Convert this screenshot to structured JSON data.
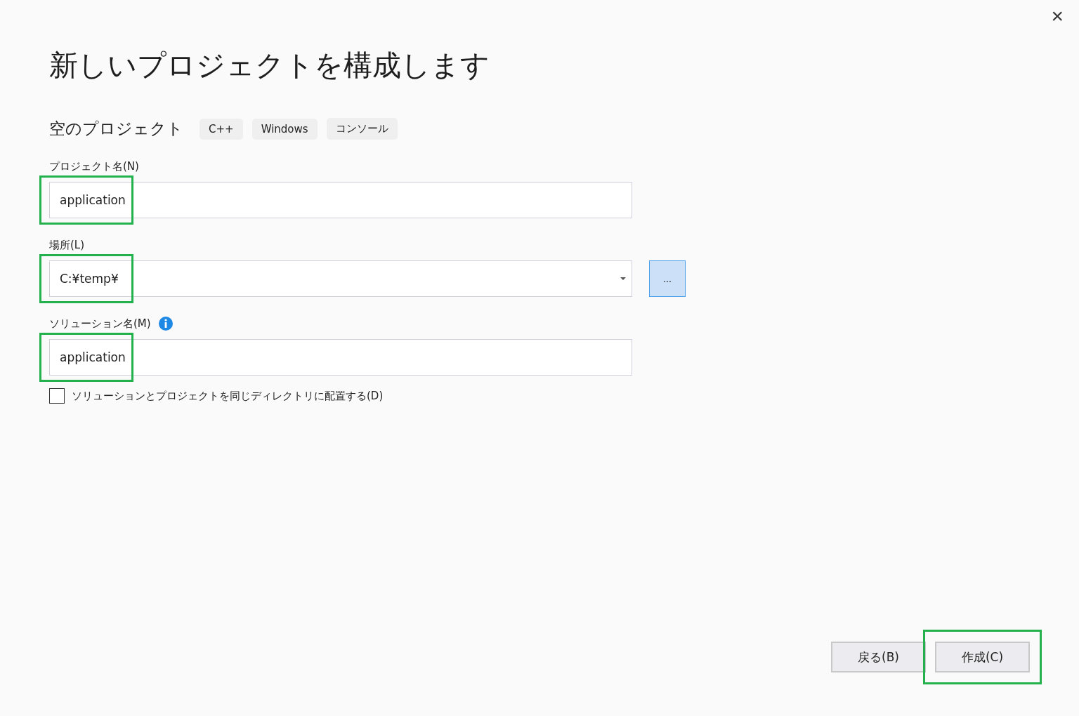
{
  "close_glyph": "×",
  "title": "新しいプロジェクトを構成します",
  "template": {
    "name": "空のプロジェクト",
    "tags": [
      "C++",
      "Windows",
      "コンソール"
    ]
  },
  "fields": [
    {
      "kind": "text",
      "label": "プロジェクト名(N)",
      "value": "application",
      "highlighted": true,
      "info": false
    },
    {
      "kind": "dropdown",
      "label": "場所(L)",
      "value": "C:¥temp¥",
      "highlighted": true,
      "info": false,
      "browse": "..."
    },
    {
      "kind": "text",
      "label": "ソリューション名(M)",
      "value": "application",
      "highlighted": true,
      "info": true
    }
  ],
  "same_directory": {
    "label": "ソリューションとプロジェクトを同じディレクトリに配置する(D)",
    "checked": false
  },
  "buttons": [
    {
      "label": "戻る(B)",
      "highlighted": false
    },
    {
      "label": "作成(C)",
      "highlighted": true
    }
  ]
}
